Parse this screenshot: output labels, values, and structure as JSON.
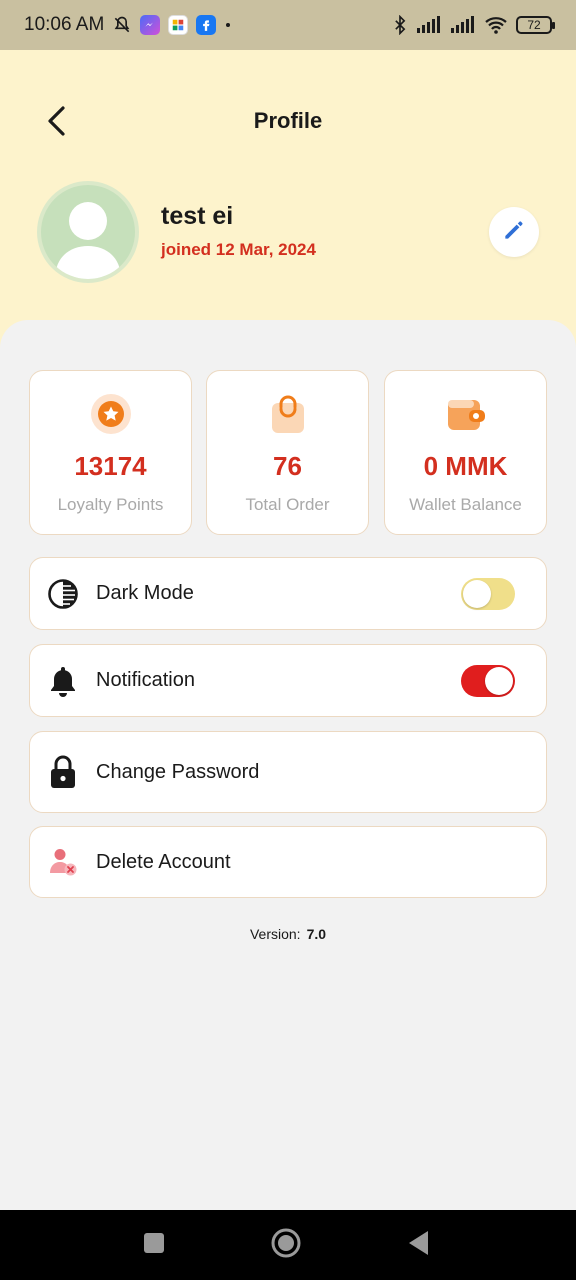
{
  "status_bar": {
    "time": "10:06 AM",
    "battery": "72"
  },
  "header": {
    "title": "Profile"
  },
  "profile": {
    "name": "test ei",
    "joined": "joined 12 Mar, 2024"
  },
  "stats": [
    {
      "icon": "star-badge-icon",
      "value": "13174",
      "label": "Loyalty Points"
    },
    {
      "icon": "shopping-bag-icon",
      "value": "76",
      "label": "Total Order"
    },
    {
      "icon": "wallet-icon",
      "value": "0 MMK",
      "label": "Wallet Balance"
    }
  ],
  "settings": [
    {
      "icon": "contrast-icon",
      "label": "Dark Mode",
      "toggle": false
    },
    {
      "icon": "bell-icon",
      "label": "Notification",
      "toggle": true
    },
    {
      "icon": "lock-icon",
      "label": "Change Password"
    },
    {
      "icon": "delete-user-icon",
      "label": "Delete Account"
    }
  ],
  "version": {
    "label": "Version:",
    "value": "7.0"
  },
  "colors": {
    "header_bg": "#fdf3cc",
    "accent_red": "#d32f1f",
    "toggle_on": "#e01e1e",
    "toggle_off": "#f0df8a",
    "avatar_green": "#c6e0bb"
  }
}
